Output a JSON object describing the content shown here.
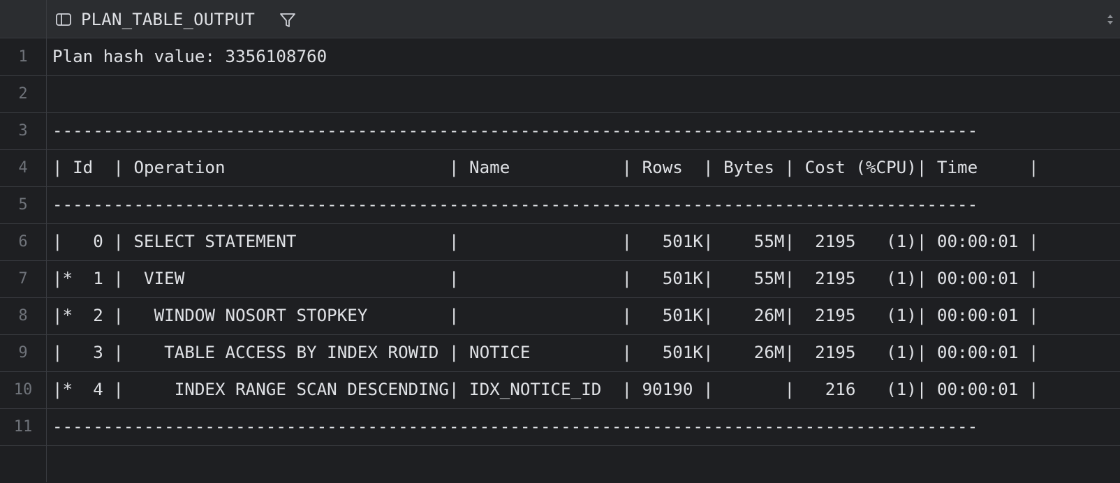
{
  "column": {
    "title": "PLAN_TABLE_OUTPUT",
    "icon": "table-column-icon",
    "filter_icon": "filter-icon",
    "sort_icon": "sort-arrows-icon"
  },
  "rows": [
    {
      "num": "1",
      "text": "Plan hash value: 3356108760"
    },
    {
      "num": "2",
      "text": ""
    },
    {
      "num": "3",
      "text": "-------------------------------------------------------------------------------------------"
    },
    {
      "num": "4",
      "text": "| Id  | Operation                      | Name           | Rows  | Bytes | Cost (%CPU)| Time     |"
    },
    {
      "num": "5",
      "text": "-------------------------------------------------------------------------------------------"
    },
    {
      "num": "6",
      "text": "|   0 | SELECT STATEMENT               |                |   501K|    55M|  2195   (1)| 00:00:01 |"
    },
    {
      "num": "7",
      "text": "|*  1 |  VIEW                          |                |   501K|    55M|  2195   (1)| 00:00:01 |"
    },
    {
      "num": "8",
      "text": "|*  2 |   WINDOW NOSORT STOPKEY        |                |   501K|    26M|  2195   (1)| 00:00:01 |"
    },
    {
      "num": "9",
      "text": "|   3 |    TABLE ACCESS BY INDEX ROWID | NOTICE         |   501K|    26M|  2195   (1)| 00:00:01 |"
    },
    {
      "num": "10",
      "text": "|*  4 |     INDEX RANGE SCAN DESCENDING| IDX_NOTICE_ID  | 90190 |       |   216   (1)| 00:00:01 |"
    },
    {
      "num": "11",
      "text": "-------------------------------------------------------------------------------------------"
    }
  ],
  "colors": {
    "background": "#1e1f22",
    "header": "#2b2d30",
    "grid_line": "#393b40",
    "text": "#dfe1e5",
    "line_number": "#6f737a"
  }
}
